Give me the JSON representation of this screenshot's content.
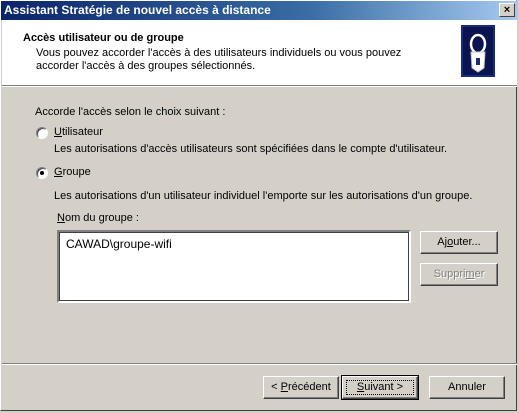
{
  "window": {
    "title": "Assistant Stratégie de nouvel accès à distance",
    "close_glyph": "×"
  },
  "header": {
    "title": "Accès utilisateur ou de groupe",
    "description": "Vous pouvez accorder l'accès à des utilisateurs individuels ou vous pouvez accorder l'accès à des groupes sélectionnés.",
    "icon": "key-lock-icon"
  },
  "body": {
    "prompt": "Accorde l'accès selon le choix suivant :",
    "options": [
      {
        "label_pre": "",
        "label_ul": "U",
        "label_post": "tilisateur",
        "description": "Les autorisations d'accès utilisateurs sont spécifiées dans le compte d'utilisateur.",
        "selected": false
      },
      {
        "label_pre": "",
        "label_ul": "G",
        "label_post": "roupe",
        "description": "Les autorisations d'un utilisateur individuel l'emporte sur les autorisations d'un groupe.",
        "selected": true
      }
    ],
    "group_label_ul": "N",
    "group_label_rest": "om du groupe :",
    "groups": [
      "CAWAD\\groupe-wifi"
    ],
    "add_button": {
      "pre": "Aj",
      "ul": "o",
      "post": "uter..."
    },
    "remove_button": {
      "pre": "Suppri",
      "ul": "m",
      "post": "er"
    }
  },
  "footer": {
    "back": {
      "pre": "< ",
      "ul": "P",
      "post": "récédent"
    },
    "next": {
      "pre": "",
      "ul": "S",
      "post": "uivant >"
    },
    "cancel": "Annuler"
  }
}
